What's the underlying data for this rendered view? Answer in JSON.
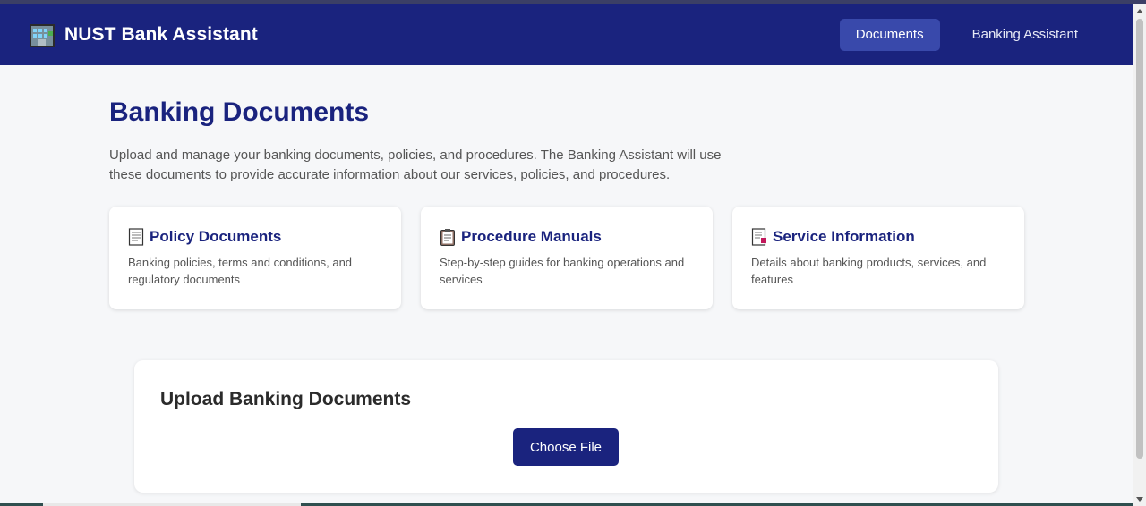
{
  "header": {
    "brand_icon": "bank-building-icon",
    "title": "NUST Bank Assistant",
    "nav": [
      {
        "label": "Documents",
        "active": true
      },
      {
        "label": "Banking Assistant",
        "active": false
      }
    ]
  },
  "main": {
    "title": "Banking Documents",
    "intro": "Upload and manage your banking documents, policies, and procedures. The Banking Assistant will use these documents to provide accurate information about our services, policies, and procedures.",
    "cards": [
      {
        "icon": "document-icon",
        "title": "Policy Documents",
        "description": "Banking policies, terms and conditions, and regulatory documents"
      },
      {
        "icon": "clipboard-icon",
        "title": "Procedure Manuals",
        "description": "Step-by-step guides for banking operations and services"
      },
      {
        "icon": "bookmark-document-icon",
        "title": "Service Information",
        "description": "Details about banking products, services, and features"
      }
    ]
  },
  "upload": {
    "title": "Upload Banking Documents",
    "button_label": "Choose File"
  },
  "colors": {
    "primary": "#1a237e",
    "active_nav": "#3949ab",
    "background": "#f6f7f9"
  }
}
